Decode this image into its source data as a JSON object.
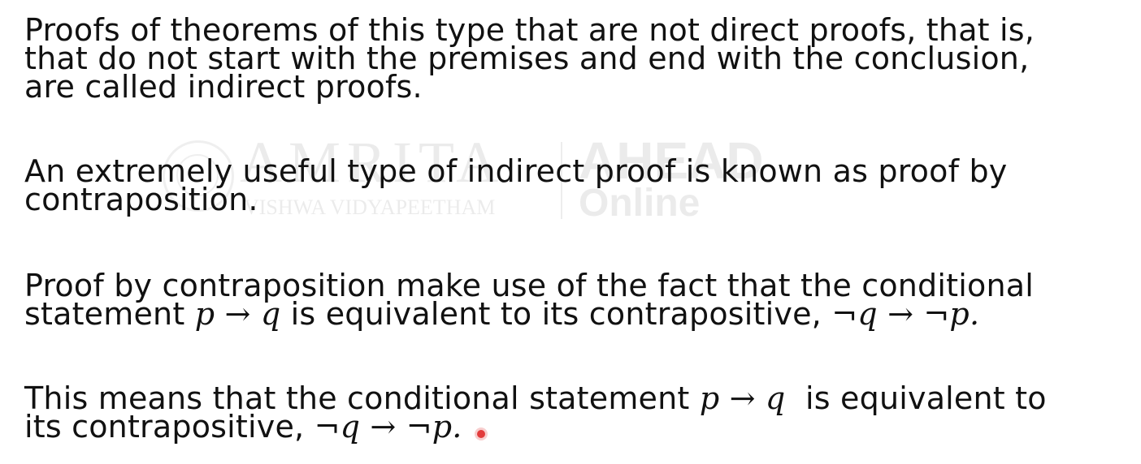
{
  "watermark": {
    "brand": "AMRITA",
    "subtitle": "VISHWA VIDYAPEETHAM",
    "partner": "AHEAD",
    "partner_sub": "Online"
  },
  "paragraphs": [
    {
      "lines": [
        "Proofs of theorems of this type that are not direct proofs, that is,",
        "that do not start with the premises and end with the conclusion,",
        "are called indirect proofs."
      ]
    },
    {
      "lines": [
        "An extremely useful type of indirect proof is known as proof by",
        "contraposition."
      ]
    },
    {
      "line1": "Proof by contraposition make use of the fact that the conditional",
      "line2_pre": "statement ",
      "line2_math1": "p → q",
      "line2_mid": " is equivalent to its contrapositive, ",
      "line2_math2": "¬q → ¬p."
    },
    {
      "line1_pre": "This means that the conditional statement ",
      "line1_math": "p → q",
      "line1_post": "  is equivalent to",
      "line2_pre": "its contrapositive, ",
      "line2_math": "¬q → ¬p."
    }
  ],
  "colors": {
    "text": "#111111",
    "background": "#ffffff",
    "pointer": "#e23b3b"
  }
}
